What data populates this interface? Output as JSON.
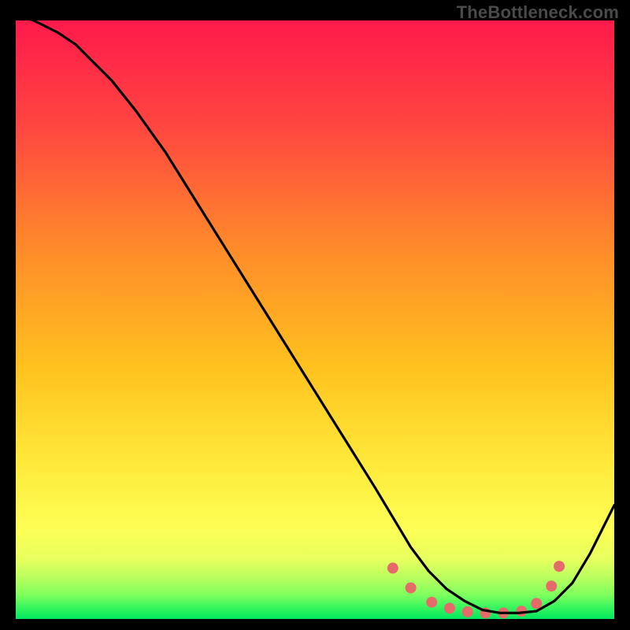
{
  "watermark": "TheBottleneck.com",
  "chart_data": {
    "type": "line",
    "title": "",
    "xlabel": "",
    "ylabel": "",
    "xlim": [
      0,
      100
    ],
    "ylim": [
      0,
      100
    ],
    "grid": false,
    "background_gradient": {
      "top": "#ff1a4b",
      "mid": "#ffd400",
      "green_band_top": "#f6ff6b",
      "green_band_mid": "#9dff5e",
      "bottom": "#00e85e"
    },
    "series": [
      {
        "name": "bottleneck-curve",
        "color": "#000000",
        "x": [
          0,
          3,
          7,
          10,
          13,
          16,
          20,
          25,
          30,
          35,
          40,
          45,
          50,
          55,
          60,
          63,
          66,
          69,
          72,
          75,
          78,
          81,
          84,
          87,
          90,
          93,
          96,
          100
        ],
        "y": [
          101,
          100,
          98,
          96,
          93,
          90,
          85,
          78,
          70,
          62,
          54,
          46,
          38,
          30,
          22,
          17,
          12,
          8,
          5,
          3,
          1.5,
          1,
          1,
          1.3,
          3,
          6,
          11,
          19
        ]
      }
    ],
    "markers": {
      "name": "highlight-dots",
      "color": "#e66a6a",
      "radius": 7,
      "points": [
        {
          "x": 63,
          "y": 8.5
        },
        {
          "x": 66,
          "y": 5.2
        },
        {
          "x": 69.5,
          "y": 2.8
        },
        {
          "x": 72.5,
          "y": 1.8
        },
        {
          "x": 75.5,
          "y": 1.2
        },
        {
          "x": 78.5,
          "y": 1.0
        },
        {
          "x": 81.5,
          "y": 1.0
        },
        {
          "x": 84.5,
          "y": 1.3
        },
        {
          "x": 87,
          "y": 2.6
        },
        {
          "x": 89.5,
          "y": 5.5
        },
        {
          "x": 90.8,
          "y": 8.8
        }
      ]
    }
  }
}
